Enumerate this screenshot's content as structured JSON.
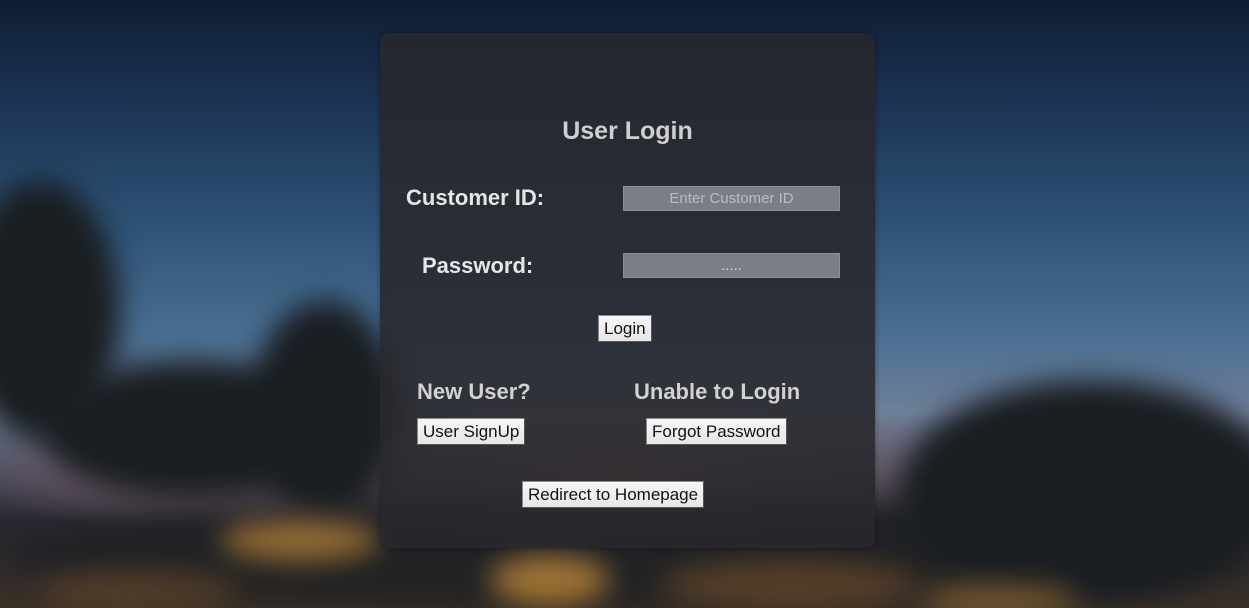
{
  "login": {
    "title": "User Login",
    "customer_id_label": "Customer ID:",
    "customer_id_placeholder": "Enter Customer ID",
    "customer_id_value": "",
    "password_label": "Password:",
    "password_value": ".....",
    "login_button": "Login"
  },
  "new_user": {
    "heading": "New User?",
    "button": "User SignUp"
  },
  "unable": {
    "heading": "Unable to Login",
    "button": "Forgot Password"
  },
  "redirect_button": "Redirect to Homepage",
  "colors": {
    "card": "#2a2a2e",
    "input_bg": "#7a7e86",
    "title_text": "#cfcfcf",
    "label_text": "#e6e6e6"
  }
}
